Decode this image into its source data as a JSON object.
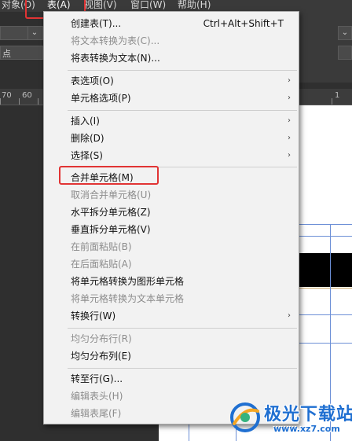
{
  "menubar": {
    "items": [
      {
        "label": "对象(O)"
      },
      {
        "label": "表(A)"
      },
      {
        "label": "视图(V)"
      },
      {
        "label": "窗口(W)"
      },
      {
        "label": "帮助(H)"
      }
    ]
  },
  "controls": {
    "row2_text": "点"
  },
  "ruler": {
    "ticks": [
      "70",
      "60",
      "1"
    ]
  },
  "table_menu": {
    "items": [
      {
        "label": "创建表(T)...",
        "shortcut": "Ctrl+Alt+Shift+T",
        "enabled": true
      },
      {
        "label": "将文本转换为表(C)...",
        "enabled": false
      },
      {
        "label": "将表转换为文本(N)...",
        "enabled": true
      },
      {
        "label": "表选项(O)",
        "submenu": true,
        "enabled": true
      },
      {
        "label": "单元格选项(P)",
        "submenu": true,
        "enabled": true
      },
      {
        "label": "插入(I)",
        "submenu": true,
        "enabled": true
      },
      {
        "label": "删除(D)",
        "submenu": true,
        "enabled": true
      },
      {
        "label": "选择(S)",
        "submenu": true,
        "enabled": true
      },
      {
        "label": "合并单元格(M)",
        "enabled": true,
        "highlighted": true
      },
      {
        "label": "取消合并单元格(U)",
        "enabled": false
      },
      {
        "label": "水平拆分单元格(Z)",
        "enabled": true
      },
      {
        "label": "垂直拆分单元格(V)",
        "enabled": true
      },
      {
        "label": "在前面粘贴(B)",
        "enabled": false
      },
      {
        "label": "在后面粘贴(A)",
        "enabled": false
      },
      {
        "label": "将单元格转换为图形单元格",
        "enabled": true
      },
      {
        "label": "将单元格转换为文本单元格",
        "enabled": false
      },
      {
        "label": "转换行(W)",
        "submenu": true,
        "enabled": true
      },
      {
        "label": "均匀分布行(R)",
        "enabled": false
      },
      {
        "label": "均匀分布列(E)",
        "enabled": true
      },
      {
        "label": "转至行(G)...",
        "enabled": true
      },
      {
        "label": "编辑表头(H)",
        "enabled": false
      },
      {
        "label": "编辑表尾(F)",
        "enabled": false
      }
    ],
    "submenu_glyph": "›"
  },
  "icons": {
    "chevron_down": "⌄",
    "chevron_right": "›"
  },
  "colors": {
    "highlight_red": "#e13434",
    "menu_bg": "#f2f2f2",
    "disabled_text": "#8c8c8c",
    "watermark_blue": "#1f6fd1"
  },
  "watermark": {
    "title": "极光下载站",
    "url": "www.xz7.com"
  }
}
